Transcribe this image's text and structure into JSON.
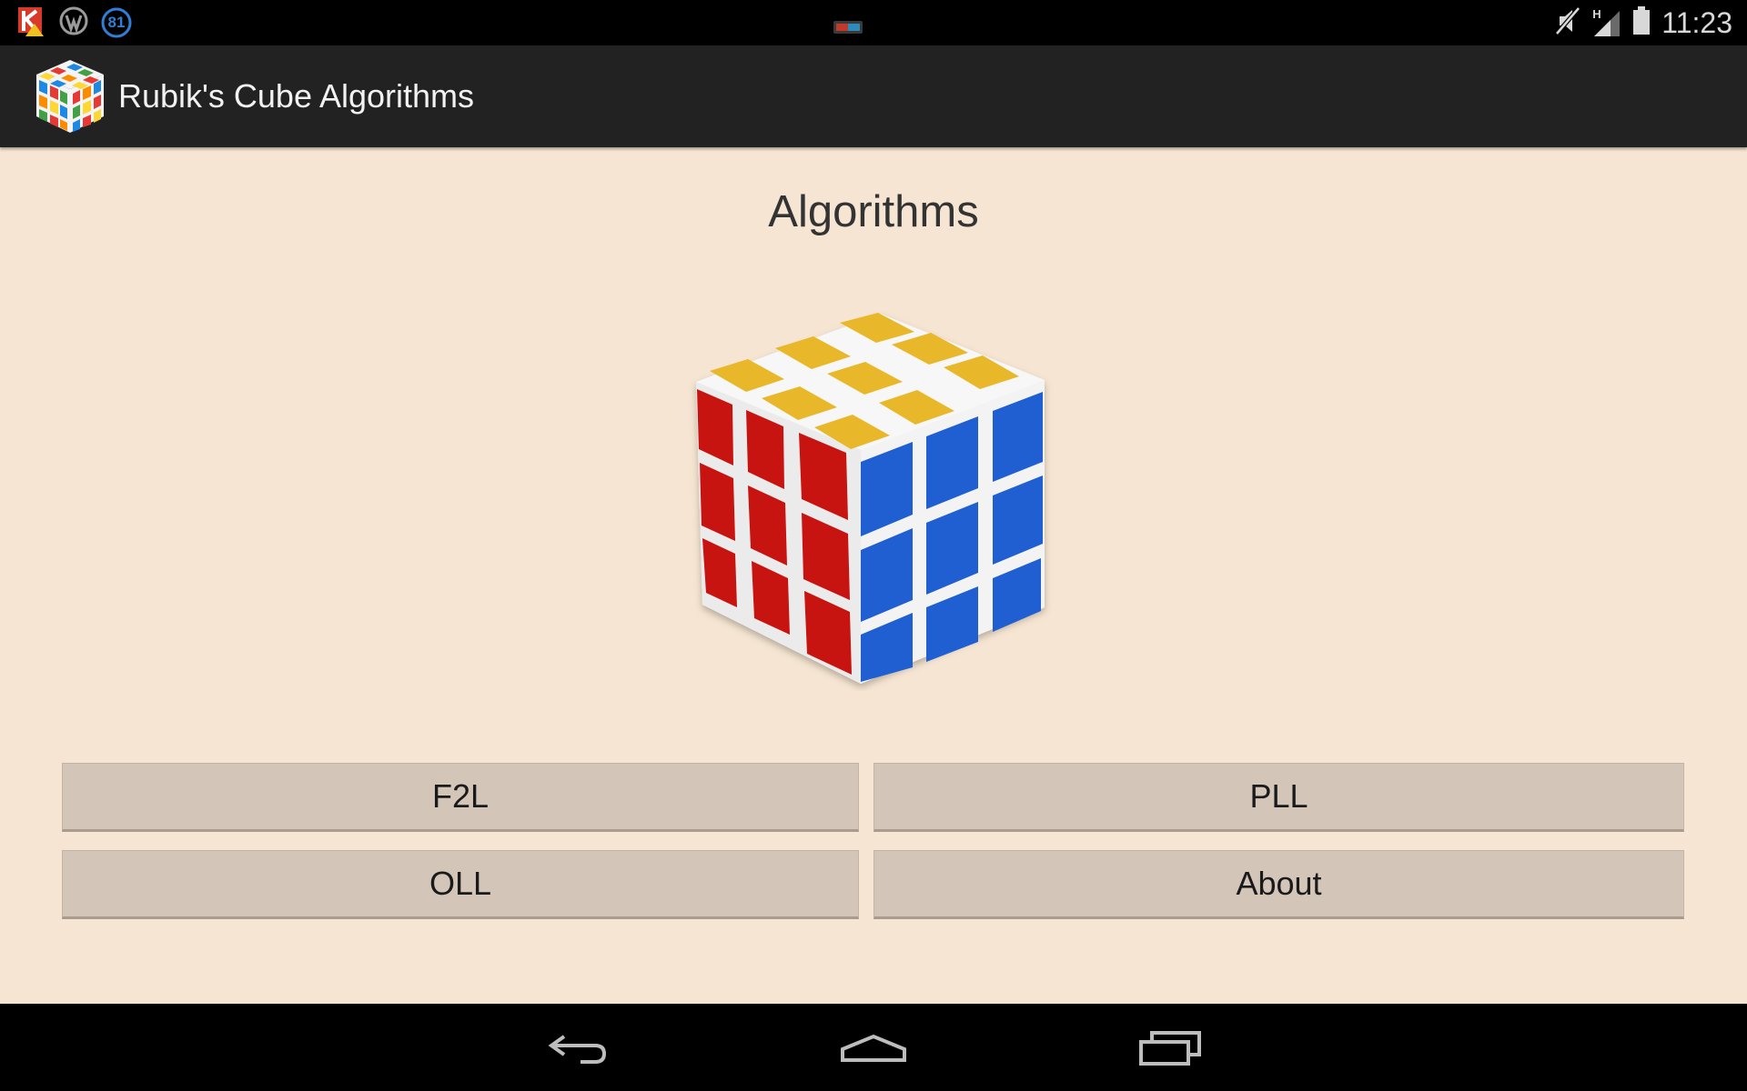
{
  "status_bar": {
    "notification_badge": "81",
    "network_type": "H",
    "time": "11:23"
  },
  "action_bar": {
    "title": "Rubik's Cube Algorithms"
  },
  "main": {
    "heading": "Algorithms",
    "buttons": {
      "f2l": "F2L",
      "pll": "PLL",
      "oll": "OLL",
      "about": "About"
    }
  },
  "icons": [
    "kaspersky-icon",
    "wordpress-icon",
    "notification-count-icon",
    "screen-cast-icon",
    "mute-icon",
    "signal-icon",
    "battery-icon",
    "app-logo-icon",
    "back-icon",
    "home-icon",
    "recent-apps-icon"
  ],
  "colors": {
    "background": "#f6e5d2",
    "action_bar": "#222222",
    "button": "#d3c6b9",
    "cube_yellow": "#e8b82a",
    "cube_red": "#c81410",
    "cube_blue": "#1f5fd2"
  }
}
